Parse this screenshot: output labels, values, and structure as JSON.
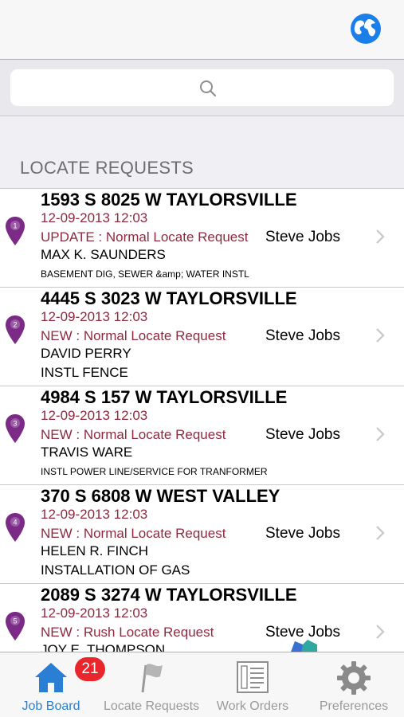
{
  "section_title": "LOCATE REQUESTS",
  "search": {
    "placeholder": ""
  },
  "requests": [
    {
      "pin_number": "1",
      "address": "1593 S 8025 W TAYLORSVILLE",
      "datetime": "12-09-2013 12:03",
      "status": "UPDATE : Normal Locate Request",
      "assignee": "Steve Jobs",
      "contact": "MAX K. SAUNDERS",
      "description": "BASEMENT DIG, SEWER &amp; WATER INSTL",
      "desc_size": "small"
    },
    {
      "pin_number": "2",
      "address": "4445 S 3023 W TAYLORSVILLE",
      "datetime": "12-09-2013 12:03",
      "status": "NEW : Normal Locate Request",
      "assignee": "Steve Jobs",
      "contact": "DAVID PERRY",
      "description": "INSTL FENCE",
      "desc_size": "large"
    },
    {
      "pin_number": "3",
      "address": "4984 S 157 W TAYLORSVILLE",
      "datetime": "12-09-2013 12:03",
      "status": "NEW : Normal Locate Request",
      "assignee": "Steve Jobs",
      "contact": "TRAVIS WARE",
      "description": "INSTL POWER LINE/SERVICE FOR TRANFORMER",
      "desc_size": "small"
    },
    {
      "pin_number": "4",
      "address": "370 S 6808 W WEST VALLEY",
      "datetime": "12-09-2013 12:03",
      "status": "NEW : Normal Locate Request",
      "assignee": "Steve Jobs",
      "contact": "HELEN R. FINCH",
      "description": "INSTALLATION OF GAS",
      "desc_size": "large"
    },
    {
      "pin_number": "5",
      "address": "2089 S 3274 W TAYLORSVILLE",
      "datetime": "12-09-2013 12:03",
      "status": "NEW : Rush Locate Request",
      "assignee": "Steve Jobs",
      "contact": "JOY E. THOMPSON",
      "description": "",
      "desc_size": "large"
    }
  ],
  "tabbar": {
    "job_board": {
      "label": "Job Board",
      "badge": "21",
      "icon": "home-icon"
    },
    "locate_requests": {
      "label": "Locate Requests",
      "icon": "flag-icon"
    },
    "work_orders": {
      "label": "Work Orders",
      "icon": "work-order-form-icon"
    },
    "preferences": {
      "label": "Preferences",
      "icon": "gear-icon"
    }
  },
  "colors": {
    "accent": "#2a7fd4",
    "status_text": "#8e2a3f",
    "pin": "#7b2b86",
    "badge": "#e8262c"
  }
}
